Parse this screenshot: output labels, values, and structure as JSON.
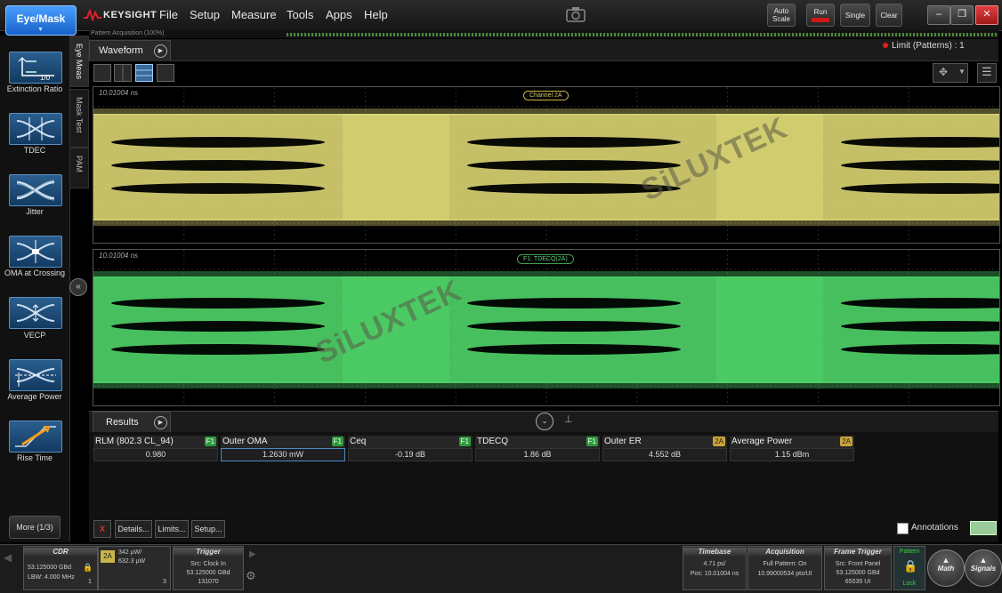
{
  "app": {
    "eye_mask_label": "Eye/Mask",
    "logo_text": "KEYSIGHT"
  },
  "menu": [
    "File",
    "Setup",
    "Measure",
    "Tools",
    "Apps",
    "Help"
  ],
  "toolbar": {
    "auto_scale": "Auto Scale",
    "run": "Run",
    "single": "Single",
    "clear": "Clear",
    "win_min": "–",
    "win_restore": "❐",
    "win_close": "✕"
  },
  "sidebar": {
    "items": [
      {
        "label": "Extinction Ratio",
        "icon": "extinction-ratio-icon",
        "icon_text": "1/0"
      },
      {
        "label": "TDEC",
        "icon": "tdec-icon"
      },
      {
        "label": "Jitter",
        "icon": "jitter-icon"
      },
      {
        "label": "OMA at Crossing",
        "icon": "oma-crossing-icon"
      },
      {
        "label": "VECP",
        "icon": "vecp-icon"
      },
      {
        "label": "Average Power",
        "icon": "average-power-icon"
      },
      {
        "label": "Rise Time",
        "icon": "rise-time-icon"
      }
    ],
    "more": "More (1/3)"
  },
  "vertical_tabs": [
    "Eye Meas",
    "Mask Test",
    "PAM"
  ],
  "progress": {
    "label": "Pattern Acquisition (100%)",
    "percent": 100
  },
  "waveform": {
    "tab": "Waveform",
    "limit": "Limit (Patterns) : 1"
  },
  "plots": [
    {
      "timestamp": "10.01004 ns",
      "channel": "Channel 2A",
      "color": "#e8e27a",
      "label_color": "#c9b44a"
    },
    {
      "timestamp": "10.01004 ns",
      "channel": "F1: TDECQ(2A)",
      "color": "#54e070",
      "label_color": "#3ea04a"
    }
  ],
  "watermark": "SiLUXTEK",
  "results": {
    "tab": "Results",
    "measurements": [
      {
        "name": "RLM (802.3 CL_94)",
        "badge": "F1",
        "value": "0.980"
      },
      {
        "name": "Outer OMA",
        "badge": "F1",
        "value": "1.2630 mW"
      },
      {
        "name": "Ceq",
        "badge": "F1",
        "value": "-0.19 dB"
      },
      {
        "name": "TDECQ",
        "badge": "F1",
        "value": "1.86 dB"
      },
      {
        "name": "Outer ER",
        "badge": "2A",
        "value": "4.552 dB"
      },
      {
        "name": "Average Power",
        "badge": "2A",
        "value": "1.15 dBm"
      }
    ],
    "buttons": {
      "details": "Details...",
      "limits": "Limits...",
      "setup": "Setup..."
    },
    "annotations": "Annotations",
    "delete_icon": "X"
  },
  "bottom": {
    "cdr": {
      "title": "CDR",
      "line1": "53.125000 GBd",
      "line2": "LBW: 4.000 MHz",
      "num": "1"
    },
    "channel": {
      "badge": "2A",
      "line1": "342 µW/",
      "line2": "632.3 µW",
      "num": "3"
    },
    "trigger": {
      "title": "Trigger",
      "line1": "Src: Clock In",
      "line2": "53.125000 GBd",
      "line3": "131070"
    },
    "timebase": {
      "title": "Timebase",
      "line1": "4.71 ps/",
      "line2": "Pos: 10.01004 ns"
    },
    "acquisition": {
      "title": "Acquisition",
      "line1": "Full Pattern: On",
      "line2": "10.99000534 pts/UI"
    },
    "frame_trigger": {
      "title": "Frame Trigger",
      "line1": "Src: Front Panel",
      "line2": "53.125000 GBd",
      "line3": "65535 UI"
    },
    "pattern": {
      "top": "Pattern",
      "bottom": "Lock"
    },
    "math": "Math",
    "signals": "Signals"
  }
}
